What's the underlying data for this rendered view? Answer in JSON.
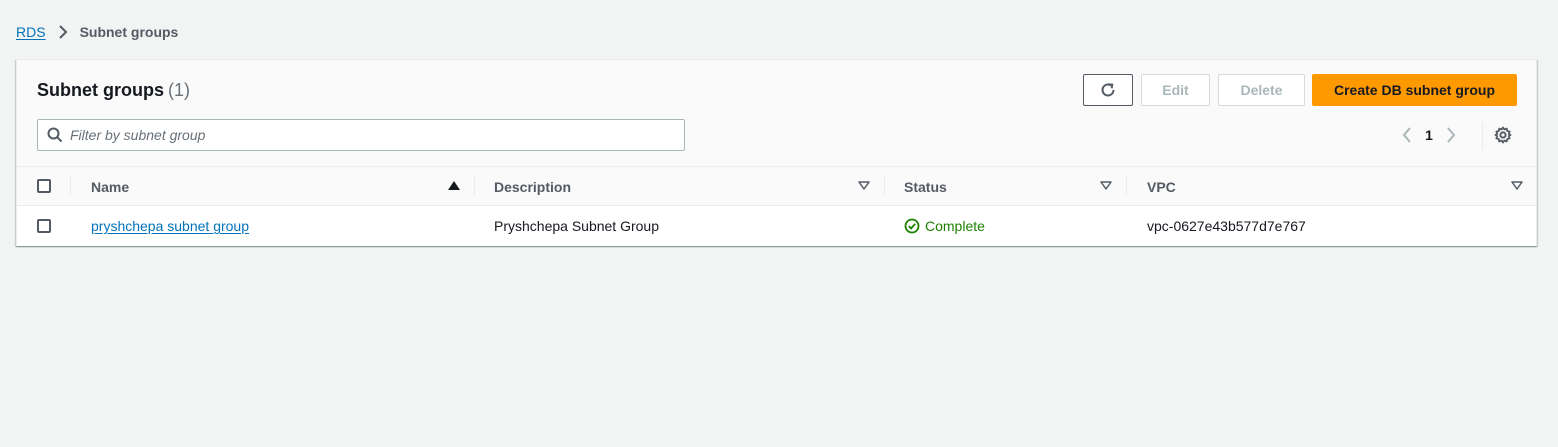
{
  "breadcrumb": {
    "root": "RDS",
    "current": "Subnet groups"
  },
  "panel": {
    "title": "Subnet groups",
    "count": "(1)"
  },
  "actions": {
    "refresh_icon": "refresh-icon",
    "edit_label": "Edit",
    "delete_label": "Delete",
    "create_label": "Create DB subnet group"
  },
  "filter": {
    "placeholder": "Filter by subnet group",
    "value": ""
  },
  "pagination": {
    "current_page": "1"
  },
  "table": {
    "columns": [
      "Name",
      "Description",
      "Status",
      "VPC"
    ],
    "rows": [
      {
        "name": "pryshchepa subnet group",
        "description": "Pryshchepa Subnet Group",
        "status": "Complete",
        "vpc": "vpc-0627e43b577d7e767"
      }
    ]
  },
  "colors": {
    "accent": "#ff9900",
    "link": "#0073bb",
    "success": "#1d8102"
  }
}
